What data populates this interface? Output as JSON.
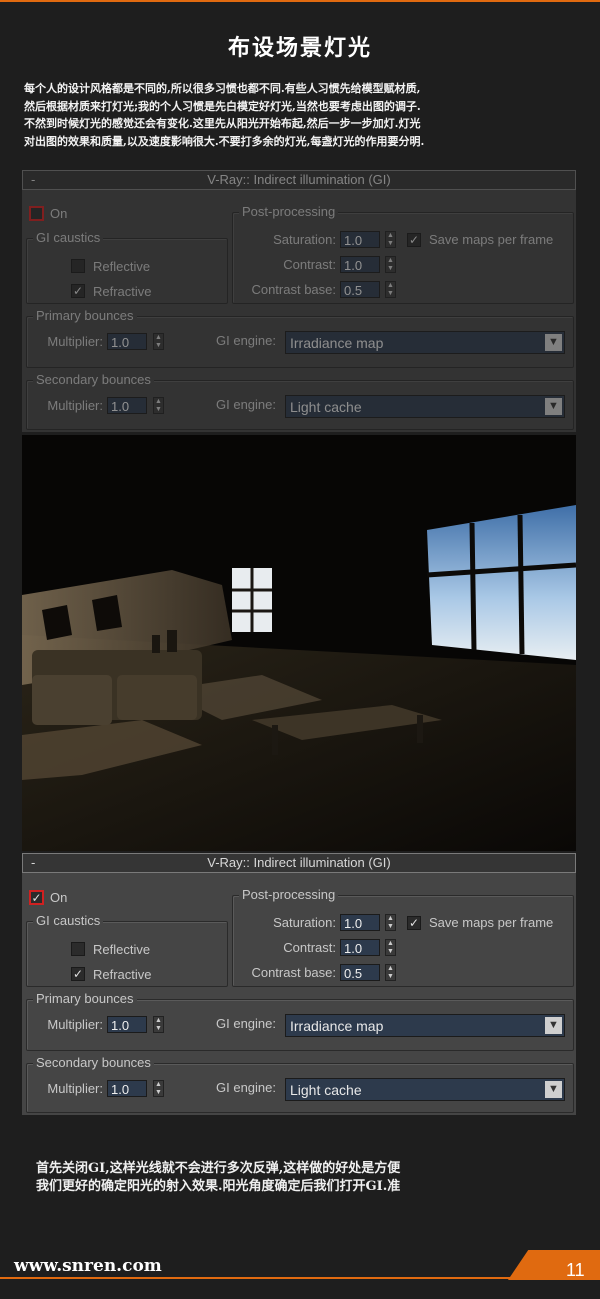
{
  "title": "布设场景灯光",
  "intro_lines": [
    "每个人的设计风格都是不同的,所以很多习惯也都不同.有些人习惯先给模型赋材质,",
    "然后根据材质来打灯光;我的个人习惯是先白模定好灯光,当然也要考虑出图的调子.",
    "不然到时候灯光的感觉还会有变化.这里先从阳光开始布起,然后一步一步加灯.灯光",
    "对出图的效果和质量,以及速度影响很大.不要打多余的灯光,每盏灯光的作用要分明."
  ],
  "panels": [
    {
      "state": "disabled",
      "header_minus": "-",
      "header": "V-Ray:: Indirect illumination (GI)",
      "on_label": "On",
      "on_checked": "",
      "gi_caustics_label": "GI caustics",
      "reflective_label": "Reflective",
      "reflective_checked": "",
      "refractive_label": "Refractive",
      "refractive_checked": "✓",
      "post_label": "Post-processing",
      "saturation_label": "Saturation:",
      "saturation_value": "1.0",
      "contrast_label": "Contrast:",
      "contrast_value": "1.0",
      "contrast_base_label": "Contrast base:",
      "contrast_base_value": "0.5",
      "save_maps_label": "Save maps per frame",
      "save_maps_checked": "✓",
      "primary_label": "Primary bounces",
      "primary_multiplier_label": "Multiplier:",
      "primary_multiplier_value": "1.0",
      "primary_engine_label": "GI engine:",
      "primary_engine_value": "Irradiance map",
      "secondary_label": "Secondary bounces",
      "secondary_multiplier_label": "Multiplier:",
      "secondary_multiplier_value": "1.0",
      "secondary_engine_label": "GI engine:",
      "secondary_engine_value": "Light cache"
    },
    {
      "state": "enabled",
      "header_minus": "-",
      "header": "V-Ray:: Indirect illumination (GI)",
      "on_label": "On",
      "on_checked": "✓",
      "gi_caustics_label": "GI caustics",
      "reflective_label": "Reflective",
      "reflective_checked": "",
      "refractive_label": "Refractive",
      "refractive_checked": "✓",
      "post_label": "Post-processing",
      "saturation_label": "Saturation:",
      "saturation_value": "1.0",
      "contrast_label": "Contrast:",
      "contrast_value": "1.0",
      "contrast_base_label": "Contrast base:",
      "contrast_base_value": "0.5",
      "save_maps_label": "Save maps per frame",
      "save_maps_checked": "✓",
      "primary_label": "Primary bounces",
      "primary_multiplier_label": "Multiplier:",
      "primary_multiplier_value": "1.0",
      "primary_engine_label": "GI engine:",
      "primary_engine_value": "Irradiance map",
      "secondary_label": "Secondary bounces",
      "secondary_multiplier_label": "Multiplier:",
      "secondary_multiplier_value": "1.0",
      "secondary_engine_label": "GI engine:",
      "secondary_engine_value": "Light cache"
    }
  ],
  "bottom_lines": [
    "首先关闭GI,这样光线就不会进行多次反弹,这样做的好处是方便",
    "我们更好的确定阳光的射入效果.阳光角度确定后我们打开GI.准"
  ],
  "footer": {
    "site": "www.snren.com",
    "page": "11"
  },
  "colors": {
    "accent": "#e06a10",
    "panel_bg": "#454545",
    "field_bg": "#2d3a4c",
    "on_checkbox_border": "#d02020"
  }
}
